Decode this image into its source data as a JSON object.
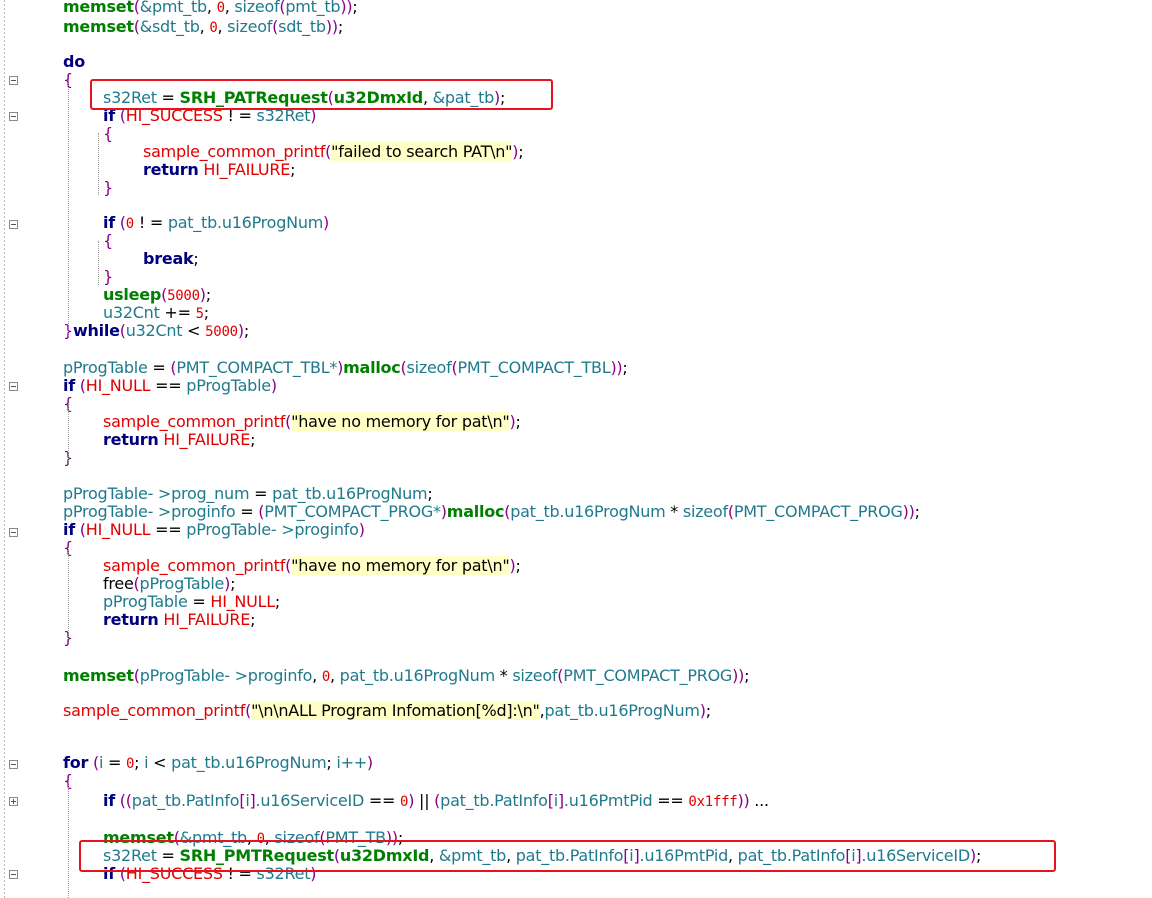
{
  "code_lines": [
    [
      {
        "c": "fn",
        "t": "memset"
      },
      {
        "c": "pn",
        "t": "("
      },
      {
        "c": "tx",
        "t": "&pmt_tb"
      },
      {
        "c": "op",
        "t": ", "
      },
      {
        "c": "nm",
        "t": "0"
      },
      {
        "c": "op",
        "t": ", "
      },
      {
        "c": "tx",
        "t": "sizeof"
      },
      {
        "c": "pn",
        "t": "("
      },
      {
        "c": "tx",
        "t": "pmt_tb"
      },
      {
        "c": "pn",
        "t": "))"
      },
      {
        "c": "op",
        "t": ";"
      }
    ],
    [
      {
        "c": "fn",
        "t": "memset"
      },
      {
        "c": "pn",
        "t": "("
      },
      {
        "c": "tx",
        "t": "&sdt_tb"
      },
      {
        "c": "op",
        "t": ", "
      },
      {
        "c": "nm",
        "t": "0"
      },
      {
        "c": "op",
        "t": ", "
      },
      {
        "c": "tx",
        "t": "sizeof"
      },
      {
        "c": "pn",
        "t": "("
      },
      {
        "c": "tx",
        "t": "sdt_tb"
      },
      {
        "c": "pn",
        "t": "))"
      },
      {
        "c": "op",
        "t": ";"
      }
    ],
    [
      {
        "c": "kw",
        "t": "do"
      }
    ],
    [
      {
        "c": "pn",
        "t": "{"
      }
    ],
    [
      {
        "c": "tx",
        "t": "s32Ret"
      },
      {
        "c": "op",
        "t": " = "
      },
      {
        "c": "fn",
        "t": "SRH_PATRequest"
      },
      {
        "c": "pn",
        "t": "("
      },
      {
        "c": "fn",
        "t": "u32DmxId"
      },
      {
        "c": "op",
        "t": ", "
      },
      {
        "c": "tx",
        "t": "&pat_tb"
      },
      {
        "c": "pn",
        "t": ")"
      },
      {
        "c": "op",
        "t": ";"
      }
    ],
    [
      {
        "c": "kw",
        "t": "if"
      },
      {
        "c": "op",
        "t": " "
      },
      {
        "c": "pn",
        "t": "("
      },
      {
        "c": "rd",
        "t": "HI_SUCCESS"
      },
      {
        "c": "op",
        "t": " ! = "
      },
      {
        "c": "tx",
        "t": "s32Ret"
      },
      {
        "c": "pn",
        "t": ")"
      }
    ],
    [
      {
        "c": "pn",
        "t": "{"
      }
    ],
    [
      {
        "c": "pf",
        "t": "sample_common_printf"
      },
      {
        "c": "pn",
        "t": "("
      },
      {
        "c": "st",
        "t": "\"failed to search PAT\\n\""
      },
      {
        "c": "pn",
        "t": ")"
      },
      {
        "c": "op",
        "t": ";"
      }
    ],
    [
      {
        "c": "kw",
        "t": "return"
      },
      {
        "c": "op",
        "t": " "
      },
      {
        "c": "rd",
        "t": "HI_FAILURE"
      },
      {
        "c": "op",
        "t": ";"
      }
    ],
    [
      {
        "c": "pn",
        "t": "}"
      }
    ],
    [
      {
        "c": "kw",
        "t": "if"
      },
      {
        "c": "op",
        "t": " "
      },
      {
        "c": "pn",
        "t": "("
      },
      {
        "c": "nm",
        "t": "0"
      },
      {
        "c": "op",
        "t": " ! = "
      },
      {
        "c": "tx",
        "t": "pat_tb.u16ProgNum"
      },
      {
        "c": "pn",
        "t": ")"
      }
    ],
    [
      {
        "c": "pn",
        "t": "{"
      }
    ],
    [
      {
        "c": "kw",
        "t": "break"
      },
      {
        "c": "op",
        "t": ";"
      }
    ],
    [
      {
        "c": "pn",
        "t": "}"
      }
    ],
    [
      {
        "c": "fn",
        "t": "usleep"
      },
      {
        "c": "pn",
        "t": "("
      },
      {
        "c": "nm",
        "t": "5000"
      },
      {
        "c": "pn",
        "t": ")"
      },
      {
        "c": "op",
        "t": ";"
      }
    ],
    [
      {
        "c": "tx",
        "t": "u32Cnt"
      },
      {
        "c": "op",
        "t": " += "
      },
      {
        "c": "nm",
        "t": "5"
      },
      {
        "c": "op",
        "t": ";"
      }
    ],
    [
      {
        "c": "pn",
        "t": "}"
      },
      {
        "c": "kw",
        "t": "while"
      },
      {
        "c": "pn",
        "t": "("
      },
      {
        "c": "tx",
        "t": "u32Cnt"
      },
      {
        "c": "op",
        "t": " < "
      },
      {
        "c": "nm",
        "t": "5000"
      },
      {
        "c": "pn",
        "t": ")"
      },
      {
        "c": "op",
        "t": ";"
      }
    ],
    [
      {
        "c": "tx",
        "t": "pProgTable"
      },
      {
        "c": "op",
        "t": " = "
      },
      {
        "c": "pn",
        "t": "("
      },
      {
        "c": "tx",
        "t": "PMT_COMPACT_TBL*"
      },
      {
        "c": "pn",
        "t": ")"
      },
      {
        "c": "fn",
        "t": "malloc"
      },
      {
        "c": "pn",
        "t": "("
      },
      {
        "c": "tx",
        "t": "sizeof"
      },
      {
        "c": "pn",
        "t": "("
      },
      {
        "c": "tx",
        "t": "PMT_COMPACT_TBL"
      },
      {
        "c": "pn",
        "t": "))"
      },
      {
        "c": "op",
        "t": ";"
      }
    ],
    [
      {
        "c": "kw",
        "t": "if"
      },
      {
        "c": "op",
        "t": " "
      },
      {
        "c": "pn",
        "t": "("
      },
      {
        "c": "rd",
        "t": "HI_NULL"
      },
      {
        "c": "op",
        "t": " == "
      },
      {
        "c": "tx",
        "t": "pProgTable"
      },
      {
        "c": "pn",
        "t": ")"
      }
    ],
    [
      {
        "c": "pn",
        "t": "{"
      }
    ],
    [
      {
        "c": "pf",
        "t": "sample_common_printf"
      },
      {
        "c": "pn",
        "t": "("
      },
      {
        "c": "st",
        "t": "\"have no memory for pat\\n\""
      },
      {
        "c": "pn",
        "t": ")"
      },
      {
        "c": "op",
        "t": ";"
      }
    ],
    [
      {
        "c": "kw",
        "t": "return"
      },
      {
        "c": "op",
        "t": " "
      },
      {
        "c": "rd",
        "t": "HI_FAILURE"
      },
      {
        "c": "op",
        "t": ";"
      }
    ],
    [
      {
        "c": "pn",
        "t": "}"
      }
    ],
    [
      {
        "c": "tx",
        "t": "pProgTable- >prog_num"
      },
      {
        "c": "op",
        "t": " = "
      },
      {
        "c": "tx",
        "t": "pat_tb.u16ProgNum"
      },
      {
        "c": "op",
        "t": ";"
      }
    ],
    [
      {
        "c": "tx",
        "t": "pProgTable- >proginfo"
      },
      {
        "c": "op",
        "t": " = "
      },
      {
        "c": "pn",
        "t": "("
      },
      {
        "c": "tx",
        "t": "PMT_COMPACT_PROG*"
      },
      {
        "c": "pn",
        "t": ")"
      },
      {
        "c": "fn",
        "t": "malloc"
      },
      {
        "c": "pn",
        "t": "("
      },
      {
        "c": "tx",
        "t": "pat_tb.u16ProgNum"
      },
      {
        "c": "op",
        "t": " * "
      },
      {
        "c": "tx",
        "t": "sizeof"
      },
      {
        "c": "pn",
        "t": "("
      },
      {
        "c": "tx",
        "t": "PMT_COMPACT_PROG"
      },
      {
        "c": "pn",
        "t": "))"
      },
      {
        "c": "op",
        "t": ";"
      }
    ],
    [
      {
        "c": "kw",
        "t": "if"
      },
      {
        "c": "op",
        "t": " "
      },
      {
        "c": "pn",
        "t": "("
      },
      {
        "c": "rd",
        "t": "HI_NULL"
      },
      {
        "c": "op",
        "t": " == "
      },
      {
        "c": "tx",
        "t": "pProgTable- >proginfo"
      },
      {
        "c": "pn",
        "t": ")"
      }
    ],
    [
      {
        "c": "pn",
        "t": "{"
      }
    ],
    [
      {
        "c": "pf",
        "t": "sample_common_printf"
      },
      {
        "c": "pn",
        "t": "("
      },
      {
        "c": "st",
        "t": "\"have no memory for pat\\n\""
      },
      {
        "c": "pn",
        "t": ")"
      },
      {
        "c": "op",
        "t": ";"
      }
    ],
    [
      {
        "c": "op",
        "t": "free"
      },
      {
        "c": "pn",
        "t": "("
      },
      {
        "c": "tx",
        "t": "pProgTable"
      },
      {
        "c": "pn",
        "t": ")"
      },
      {
        "c": "op",
        "t": ";"
      }
    ],
    [
      {
        "c": "tx",
        "t": "pProgTable"
      },
      {
        "c": "op",
        "t": " = "
      },
      {
        "c": "rd",
        "t": "HI_NULL"
      },
      {
        "c": "op",
        "t": ";"
      }
    ],
    [
      {
        "c": "kw",
        "t": "return"
      },
      {
        "c": "op",
        "t": " "
      },
      {
        "c": "rd",
        "t": "HI_FAILURE"
      },
      {
        "c": "op",
        "t": ";"
      }
    ],
    [
      {
        "c": "pn",
        "t": "}"
      }
    ],
    [
      {
        "c": "fn",
        "t": "memset"
      },
      {
        "c": "pn",
        "t": "("
      },
      {
        "c": "tx",
        "t": "pProgTable- >proginfo"
      },
      {
        "c": "op",
        "t": ", "
      },
      {
        "c": "nm",
        "t": "0"
      },
      {
        "c": "op",
        "t": ", "
      },
      {
        "c": "tx",
        "t": "pat_tb.u16ProgNum"
      },
      {
        "c": "op",
        "t": " * "
      },
      {
        "c": "tx",
        "t": "sizeof"
      },
      {
        "c": "pn",
        "t": "("
      },
      {
        "c": "tx",
        "t": "PMT_COMPACT_PROG"
      },
      {
        "c": "pn",
        "t": "))"
      },
      {
        "c": "op",
        "t": ";"
      }
    ],
    [
      {
        "c": "pf",
        "t": "sample_common_printf"
      },
      {
        "c": "pn",
        "t": "("
      },
      {
        "c": "st",
        "t": "\"\\n\\nALL Program Infomation[%d]:\\n\""
      },
      {
        "c": "op",
        "t": ","
      },
      {
        "c": "tx",
        "t": "pat_tb.u16ProgNum"
      },
      {
        "c": "pn",
        "t": ")"
      },
      {
        "c": "op",
        "t": ";"
      }
    ],
    [
      {
        "c": "kw",
        "t": "for"
      },
      {
        "c": "op",
        "t": " "
      },
      {
        "c": "pn",
        "t": "("
      },
      {
        "c": "tx",
        "t": "i"
      },
      {
        "c": "op",
        "t": " = "
      },
      {
        "c": "nm",
        "t": "0"
      },
      {
        "c": "op",
        "t": "; "
      },
      {
        "c": "tx",
        "t": "i"
      },
      {
        "c": "op",
        "t": " < "
      },
      {
        "c": "tx",
        "t": "pat_tb.u16ProgNum"
      },
      {
        "c": "op",
        "t": "; "
      },
      {
        "c": "tx",
        "t": "i++"
      },
      {
        "c": "pn",
        "t": ")"
      }
    ],
    [
      {
        "c": "pn",
        "t": "{"
      }
    ],
    [
      {
        "c": "kw",
        "t": "if"
      },
      {
        "c": "op",
        "t": " "
      },
      {
        "c": "pn",
        "t": "(("
      },
      {
        "c": "tx",
        "t": "pat_tb.PatInfo"
      },
      {
        "c": "pn",
        "t": "["
      },
      {
        "c": "tx",
        "t": "i"
      },
      {
        "c": "pn",
        "t": "]"
      },
      {
        "c": "tx",
        "t": ".u16ServiceID"
      },
      {
        "c": "op",
        "t": " == "
      },
      {
        "c": "nm",
        "t": "0"
      },
      {
        "c": "pn",
        "t": ")"
      },
      {
        "c": "op",
        "t": " || "
      },
      {
        "c": "pn",
        "t": "("
      },
      {
        "c": "tx",
        "t": "pat_tb.PatInfo"
      },
      {
        "c": "pn",
        "t": "["
      },
      {
        "c": "tx",
        "t": "i"
      },
      {
        "c": "pn",
        "t": "]"
      },
      {
        "c": "tx",
        "t": ".u16PmtPid"
      },
      {
        "c": "op",
        "t": " == "
      },
      {
        "c": "nm",
        "t": "0x1fff"
      },
      {
        "c": "pn",
        "t": "))"
      },
      {
        "c": "op",
        "t": " ..."
      }
    ],
    [
      {
        "c": "fn",
        "t": "memset"
      },
      {
        "c": "pn",
        "t": "("
      },
      {
        "c": "tx",
        "t": "&pmt_tb"
      },
      {
        "c": "op",
        "t": ", "
      },
      {
        "c": "nm",
        "t": "0"
      },
      {
        "c": "op",
        "t": ", "
      },
      {
        "c": "tx",
        "t": "sizeof"
      },
      {
        "c": "pn",
        "t": "("
      },
      {
        "c": "tx",
        "t": "PMT_TB"
      },
      {
        "c": "pn",
        "t": "))"
      },
      {
        "c": "op",
        "t": ";"
      }
    ],
    [
      {
        "c": "tx",
        "t": "s32Ret"
      },
      {
        "c": "op",
        "t": " = "
      },
      {
        "c": "fn",
        "t": "SRH_PMTRequest"
      },
      {
        "c": "pn",
        "t": "("
      },
      {
        "c": "fn",
        "t": "u32DmxId"
      },
      {
        "c": "op",
        "t": ", "
      },
      {
        "c": "tx",
        "t": "&pmt_tb"
      },
      {
        "c": "op",
        "t": ", "
      },
      {
        "c": "tx",
        "t": "pat_tb.PatInfo"
      },
      {
        "c": "pn",
        "t": "["
      },
      {
        "c": "tx",
        "t": "i"
      },
      {
        "c": "pn",
        "t": "]"
      },
      {
        "c": "tx",
        "t": ".u16PmtPid"
      },
      {
        "c": "op",
        "t": ", "
      },
      {
        "c": "tx",
        "t": "pat_tb.PatInfo"
      },
      {
        "c": "pn",
        "t": "["
      },
      {
        "c": "tx",
        "t": "i"
      },
      {
        "c": "pn",
        "t": "]"
      },
      {
        "c": "tx",
        "t": ".u16ServiceID"
      },
      {
        "c": "pn",
        "t": ")"
      },
      {
        "c": "op",
        "t": ";"
      }
    ],
    [
      {
        "c": "kw",
        "t": "if"
      },
      {
        "c": "op",
        "t": " "
      },
      {
        "c": "pn",
        "t": "("
      },
      {
        "c": "rd",
        "t": "HI_SUCCESS"
      },
      {
        "c": "op",
        "t": " ! = "
      },
      {
        "c": "tx",
        "t": "s32Ret"
      },
      {
        "c": "pn",
        "t": ")"
      }
    ]
  ],
  "colors": {
    "keyword": "#00007f",
    "function": "#008000",
    "identifier": "#1f7a8c",
    "constant": "#e00000",
    "paren": "#8b008b",
    "string_bg": "#ffffc6",
    "highlight_box": "#e8121e"
  },
  "fold_icons": [
    "minus-icon",
    "plus-icon"
  ]
}
